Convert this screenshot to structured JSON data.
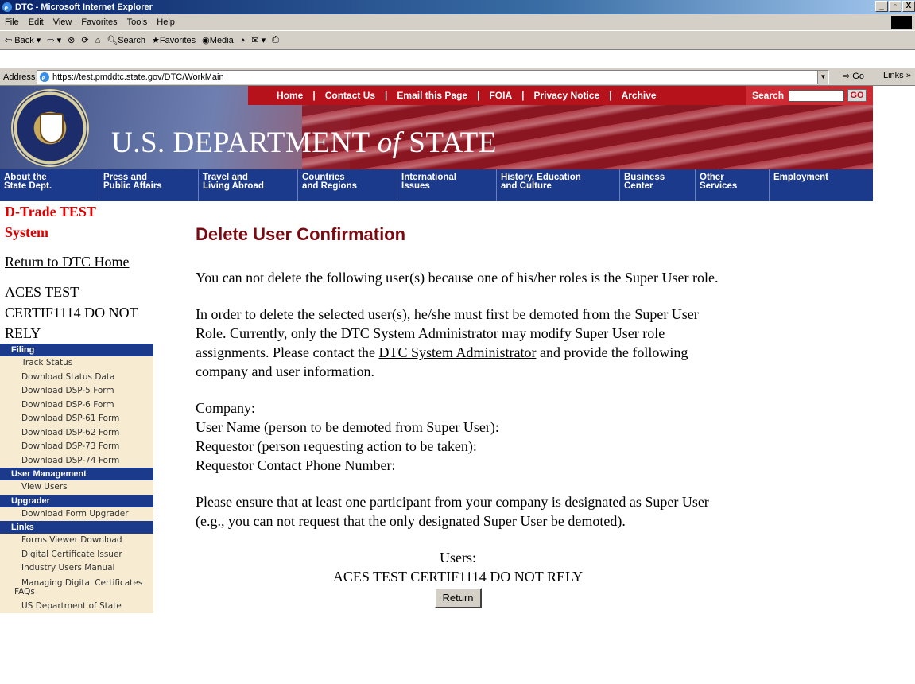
{
  "window": {
    "title": "DTC - Microsoft Internet Explorer",
    "buttons": [
      "_",
      "▫",
      "X"
    ]
  },
  "menu": [
    "File",
    "Edit",
    "View",
    "Favorites",
    "Tools",
    "Help"
  ],
  "toolbar": {
    "back": "Back",
    "search": "Search",
    "favorites": "Favorites",
    "media": "Media"
  },
  "address": {
    "label": "Address",
    "url": "https://test.pmddtc.state.gov/DTC/WorkMain",
    "go": "Go",
    "links": "Links"
  },
  "banner": {
    "title_pre": "U.S. DEPARTMENT ",
    "title_of": "of",
    "title_post": " STATE",
    "top_nav": [
      "Home",
      "Contact Us",
      "Email this Page",
      "FOIA",
      "Privacy Notice",
      "Archive"
    ],
    "search_label": "Search",
    "search_go": "GO",
    "main_nav": [
      "About the\nState Dept.",
      "Press and\nPublic Affairs",
      "Travel and\nLiving Abroad",
      "Countries\nand Regions",
      "International\nIssues",
      "History, Education\nand Culture",
      "Business\nCenter",
      "Other\nServices",
      "Employment"
    ]
  },
  "sidebar": {
    "system_title": "D-Trade TEST System",
    "return_link": "Return to DTC Home",
    "user_name": "ACES TEST CERTIF1114 DO NOT RELY",
    "sections": [
      {
        "header": "Filing",
        "items": [
          "Track Status",
          "Download Status Data",
          "Download DSP-5 Form",
          "Download DSP-6 Form",
          "Download DSP-61 Form",
          "Download DSP-62 Form",
          "Download DSP-73 Form",
          "Download DSP-74 Form"
        ]
      },
      {
        "header": "User Management",
        "items": [
          "View Users"
        ]
      },
      {
        "header": "Upgrader",
        "items": [
          "Download Form Upgrader"
        ]
      },
      {
        "header": "Links",
        "items": [
          "Forms Viewer Download",
          "Digital Certificate Issuer",
          "Industry Users Manual",
          "Managing Digital Certificates FAQs",
          "US Department of State"
        ]
      }
    ]
  },
  "content": {
    "title": "Delete User Confirmation",
    "para1": "You can not delete the following user(s) because one of his/her roles is the Super User role.",
    "para2_pre": "In order to delete the selected user(s), he/she must first be demoted from the Super User Role. Currently, only the DTC System Administrator may modify Super User role assignments. Please contact the ",
    "para2_link": "DTC System Administrator",
    "para2_post": " and provide the following company and user information.",
    "fields": [
      "Company:",
      "User Name (person to be demoted from Super User):",
      "Requestor (person requesting action to be taken):",
      "Requestor Contact Phone Number:"
    ],
    "para3": "Please ensure that at least one participant from your company is designated as Super User (e.g., you can not request that the only designated Super User be demoted).",
    "users_label": "Users:",
    "users_value": "ACES TEST CERTIF1114 DO NOT RELY",
    "return_button": "Return"
  }
}
